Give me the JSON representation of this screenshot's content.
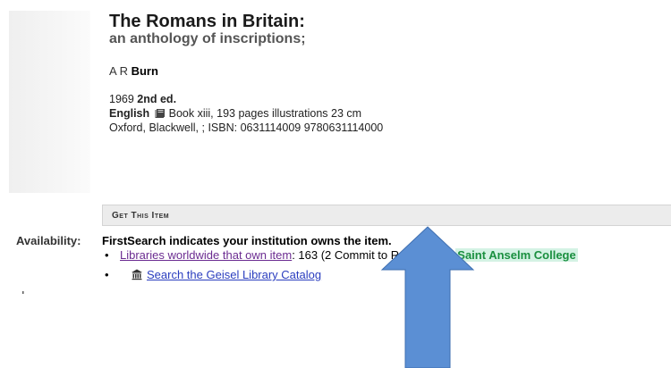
{
  "book": {
    "title": "The Romans in Britain:",
    "subtitle": "an anthology of inscriptions;",
    "author_initials": "A R ",
    "author_surname": "Burn",
    "year": "1969 ",
    "edition": "2nd ed.",
    "language": "English",
    "format": "Book xiii, 193 pages illustrations 23 cm",
    "publisher_isbn": "Oxford, Blackwell, ; ISBN: 0631114009 9780631114000"
  },
  "get_item": {
    "section_label": "Get This Item",
    "availability_label": "Availability:",
    "availability_text": "FirstSearch indicates your institution owns the item.",
    "libraries_link": "Libraries worldwide that own item",
    "libraries_count": ": 163 (2 Commit to Retain)",
    "institution": "Saint Anselm College",
    "catalog_link": "Search the Geisel Library Catalog"
  },
  "colors": {
    "link": "#2a3dbf",
    "visited_link": "#6b2c91",
    "institution_green": "#1a8f3f",
    "arrow_fill": "#5b8fd4"
  }
}
